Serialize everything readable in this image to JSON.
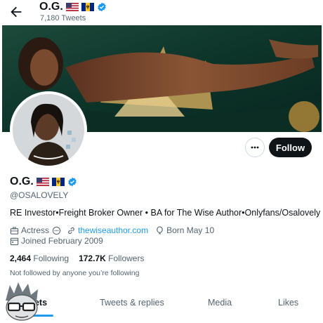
{
  "header": {
    "name": "O.G.",
    "tweet_count": "7,180 Tweets"
  },
  "actions": {
    "follow_label": "Follow"
  },
  "profile": {
    "display_name": "O.G.",
    "handle": "@OSALOVELY",
    "bio": "RE Investor•Freight Broker Owner • BA for The Wise Author•Onlyfans/Osalovely",
    "category": "Actress",
    "website": "thewiseauthor.com",
    "birthday": "Born May 10",
    "joined": "Joined February 2009",
    "following_count": "2,464",
    "following_label": "Following",
    "followers_count": "172.7K",
    "followers_label": "Followers",
    "not_followed_text": "Not followed by anyone you’re following"
  },
  "tabs": [
    {
      "label": "Tweets",
      "active": true
    },
    {
      "label": "Tweets & replies",
      "active": false
    },
    {
      "label": "Media",
      "active": false
    },
    {
      "label": "Likes",
      "active": false
    }
  ],
  "tab_partial": "eets",
  "colors": {
    "accent": "#1d9bf0",
    "text_primary": "#0f1419",
    "text_secondary": "#536471",
    "follow_button_bg": "#0f1419"
  },
  "icons": {
    "back": "arrow-left-icon",
    "verified": "verified-badge-icon",
    "more": "more-dots-icon",
    "category": "briefcase-icon",
    "website": "link-icon",
    "birthday": "balloon-icon",
    "joined": "calendar-icon",
    "sun": "sun-emoji-icon"
  }
}
